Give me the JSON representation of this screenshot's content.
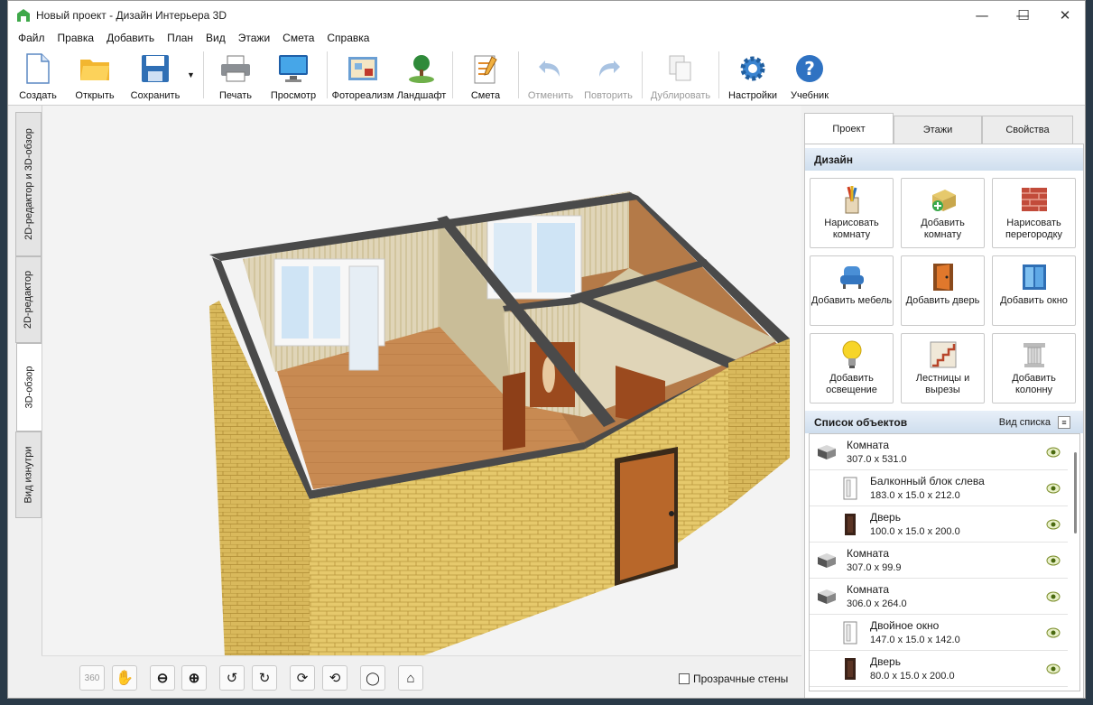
{
  "window": {
    "title": "Новый проект - Дизайн Интерьера 3D"
  },
  "menu": [
    "Файл",
    "Правка",
    "Добавить",
    "План",
    "Вид",
    "Этажи",
    "Смета",
    "Справка"
  ],
  "toolbar": {
    "create": "Создать",
    "open": "Открыть",
    "save": "Сохранить",
    "print": "Печать",
    "preview": "Просмотр",
    "photo": "Фотореализм",
    "landscape": "Ландшафт",
    "estimate": "Смета",
    "undo": "Отменить",
    "redo": "Повторить",
    "duplicate": "Дублировать",
    "settings": "Настройки",
    "tutorial": "Учебник"
  },
  "left_tabs": [
    "2D-редактор и 3D-обзор",
    "2D-редактор",
    "3D-обзор",
    "Вид изнутри"
  ],
  "left_tab_active": "3D-обзор",
  "view_controls": {
    "transparent_walls": "Прозрачные стены",
    "rotate360": "360"
  },
  "right_tabs": [
    "Проект",
    "Этажи",
    "Свойства"
  ],
  "right_tab_active": "Проект",
  "design": {
    "header": "Дизайн",
    "buttons": [
      {
        "label": "Нарисовать комнату",
        "icon": "pencils-icon"
      },
      {
        "label": "Добавить комнату",
        "icon": "add-room-icon"
      },
      {
        "label": "Нарисовать перегородку",
        "icon": "brick-wall-icon"
      },
      {
        "label": "Добавить мебель",
        "icon": "armchair-icon"
      },
      {
        "label": "Добавить дверь",
        "icon": "door-icon"
      },
      {
        "label": "Добавить окно",
        "icon": "window-icon"
      },
      {
        "label": "Добавить освещение",
        "icon": "lightbulb-icon"
      },
      {
        "label": "Лестницы и вырезы",
        "icon": "stairs-icon"
      },
      {
        "label": "Добавить колонну",
        "icon": "column-icon"
      }
    ]
  },
  "objects": {
    "header": "Список объектов",
    "view_label": "Вид списка",
    "items": [
      {
        "name": "Комната",
        "dims": "307.0 x 531.0",
        "kind": "room",
        "indent": false
      },
      {
        "name": "Балконный блок слева",
        "dims": "183.0 x 15.0 x 212.0",
        "kind": "window",
        "indent": true
      },
      {
        "name": "Дверь",
        "dims": "100.0 x 15.0 x 200.0",
        "kind": "door",
        "indent": true
      },
      {
        "name": "Комната",
        "dims": "307.0 x 99.9",
        "kind": "room",
        "indent": false
      },
      {
        "name": "Комната",
        "dims": "306.0 x 264.0",
        "kind": "room",
        "indent": false
      },
      {
        "name": "Двойное окно",
        "dims": "147.0 x 15.0 x 142.0",
        "kind": "window",
        "indent": true
      },
      {
        "name": "Дверь",
        "dims": "80.0 x 15.0 x 200.0",
        "kind": "door",
        "indent": true
      }
    ]
  },
  "colors": {
    "accent": "#2f6fb5",
    "brick": "#e3c56a",
    "floor": "#c98b55",
    "wall_top": "#4a4a4a",
    "header_grad": "#d7e4f2"
  }
}
